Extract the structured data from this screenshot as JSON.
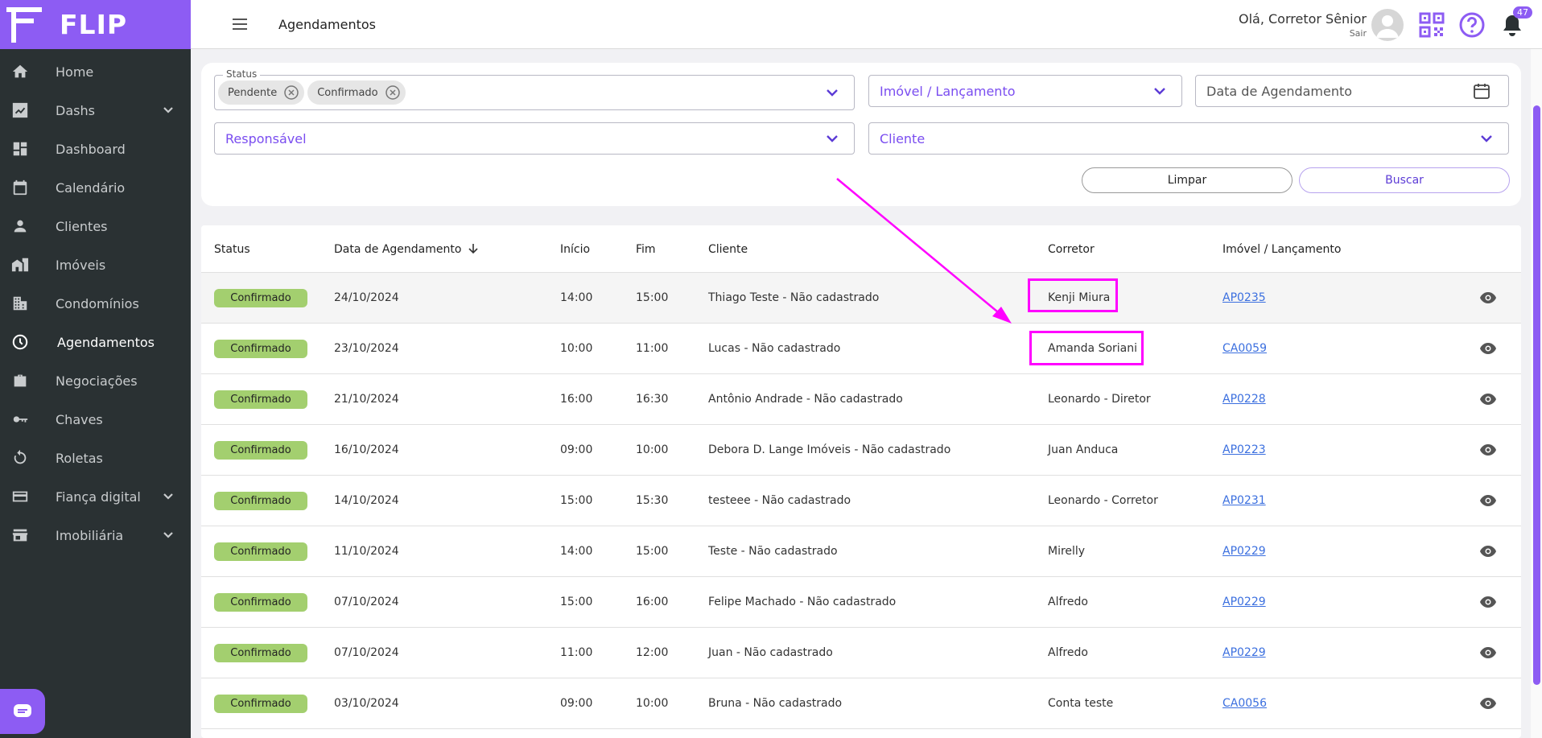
{
  "app": {
    "brand": "FLIP"
  },
  "sidebar": {
    "items": [
      {
        "label": "Home",
        "icon": "home-icon"
      },
      {
        "label": "Dashs",
        "icon": "chart-icon",
        "expandable": true
      },
      {
        "label": "Dashboard",
        "icon": "dashboard-icon"
      },
      {
        "label": "Calendário",
        "icon": "calendar-icon"
      },
      {
        "label": "Clientes",
        "icon": "person-icon"
      },
      {
        "label": "Imóveis",
        "icon": "buildings-icon"
      },
      {
        "label": "Condomínios",
        "icon": "condo-icon"
      },
      {
        "label": "Agendamentos",
        "icon": "clock-icon",
        "active": true
      },
      {
        "label": "Negociações",
        "icon": "briefcase-icon"
      },
      {
        "label": "Chaves",
        "icon": "key-icon"
      },
      {
        "label": "Roletas",
        "icon": "rotate-icon"
      },
      {
        "label": "Fiança digital",
        "icon": "card-icon",
        "expandable": true
      },
      {
        "label": "Imobiliária",
        "icon": "store-icon",
        "expandable": true
      }
    ]
  },
  "header": {
    "title": "Agendamentos",
    "greeting": "Olá, Corretor Sênior",
    "logout": "Sair",
    "notifications": "47"
  },
  "filters": {
    "status_label": "Status",
    "status_chips": [
      "Pendente",
      "Confirmado"
    ],
    "imovel_placeholder": "Imóvel / Lançamento",
    "date_placeholder": "Data de Agendamento",
    "responsavel_placeholder": "Responsável",
    "cliente_placeholder": "Cliente",
    "clear_label": "Limpar",
    "search_label": "Buscar"
  },
  "table": {
    "headers": {
      "status": "Status",
      "date": "Data de Agendamento",
      "start": "Início",
      "end": "Fim",
      "client": "Cliente",
      "broker": "Corretor",
      "property": "Imóvel / Lançamento"
    },
    "rows": [
      {
        "status": "Confirmado",
        "date": "24/10/2024",
        "start": "14:00",
        "end": "15:00",
        "client": "Thiago Teste - Não cadastrado",
        "broker": "Kenji Miura",
        "property": "AP0235"
      },
      {
        "status": "Confirmado",
        "date": "23/10/2024",
        "start": "10:00",
        "end": "11:00",
        "client": "Lucas - Não cadastrado",
        "broker": "Amanda Soriani",
        "property": "CA0059"
      },
      {
        "status": "Confirmado",
        "date": "21/10/2024",
        "start": "16:00",
        "end": "16:30",
        "client": "Antônio Andrade - Não cadastrado",
        "broker": "Leonardo - Diretor",
        "property": "AP0228"
      },
      {
        "status": "Confirmado",
        "date": "16/10/2024",
        "start": "09:00",
        "end": "10:00",
        "client": "Debora D. Lange Imóveis - Não cadastrado",
        "broker": "Juan Anduca",
        "property": "AP0223"
      },
      {
        "status": "Confirmado",
        "date": "14/10/2024",
        "start": "15:00",
        "end": "15:30",
        "client": "testeee - Não cadastrado",
        "broker": "Leonardo - Corretor",
        "property": "AP0231"
      },
      {
        "status": "Confirmado",
        "date": "11/10/2024",
        "start": "14:00",
        "end": "15:00",
        "client": "Teste - Não cadastrado",
        "broker": "Mirelly",
        "property": "AP0229"
      },
      {
        "status": "Confirmado",
        "date": "07/10/2024",
        "start": "15:00",
        "end": "16:00",
        "client": "Felipe Machado - Não cadastrado",
        "broker": "Alfredo",
        "property": "AP0229"
      },
      {
        "status": "Confirmado",
        "date": "07/10/2024",
        "start": "11:00",
        "end": "12:00",
        "client": "Juan - Não cadastrado",
        "broker": "Alfredo",
        "property": "AP0229"
      },
      {
        "status": "Confirmado",
        "date": "03/10/2024",
        "start": "09:00",
        "end": "10:00",
        "client": "Bruna - Não cadastrado",
        "broker": "Conta teste",
        "property": "CA0056"
      }
    ]
  },
  "colors": {
    "brand": "#8d5cf3",
    "sidebar": "#2a3133",
    "status_confirmed": "#a3cf6f",
    "annotation": "#ff00ff"
  }
}
